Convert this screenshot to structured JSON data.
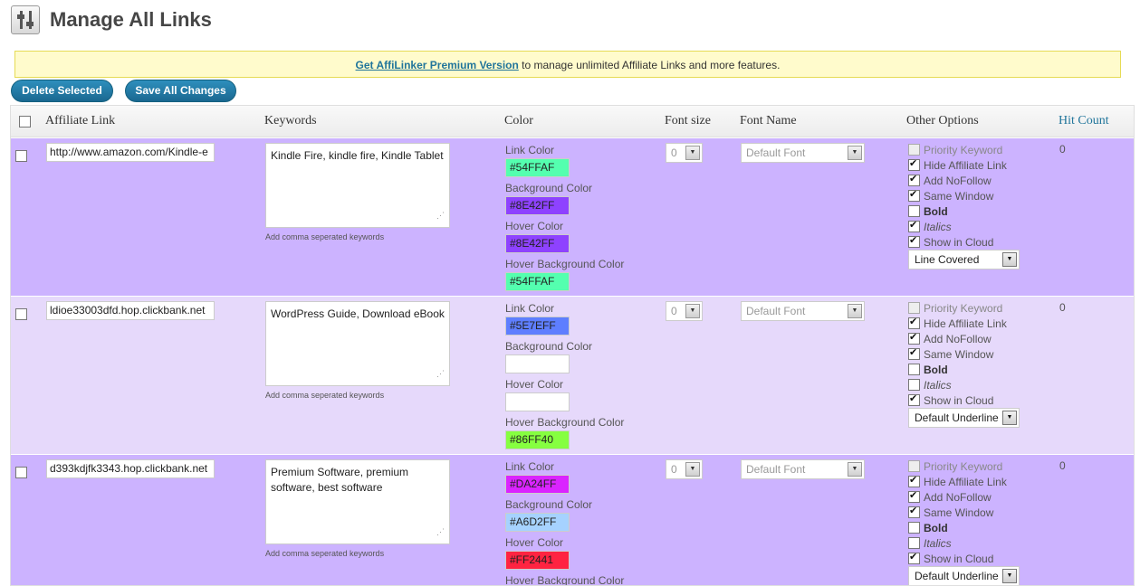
{
  "page": {
    "title": "Manage All Links"
  },
  "notice": {
    "link_text": "Get AffiLinker Premium Version",
    "text": " to manage unlimited Affiliate Links and more features."
  },
  "toolbar": {
    "delete_label": "Delete Selected",
    "save_label": "Save All Changes"
  },
  "table": {
    "headers": {
      "link": "Affiliate Link",
      "keywords": "Keywords",
      "color": "Color",
      "font_size": "Font size",
      "font_name": "Font Name",
      "other": "Other Options",
      "hit_count": "Hit Count"
    },
    "keyword_hint": "Add comma seperated keywords",
    "color_labels": {
      "link": "Link Color",
      "background": "Background Color",
      "hover": "Hover Color",
      "hover_bg": "Hover Background Color"
    },
    "option_labels": {
      "priority": "Priority Keyword",
      "hide": "Hide Affiliate Link",
      "nofollow": "Add NoFollow",
      "same_window": "Same Window",
      "bold": "Bold",
      "italics": "Italics",
      "cloud": "Show in Cloud"
    },
    "rows": [
      {
        "url": "http://www.amazon.com/Kindle-e",
        "keywords": "Kindle Fire, kindle fire, Kindle Tablet",
        "link_color": "#54FFAF",
        "bg_color": "#8E42FF",
        "hover_color": "#8E42FF",
        "hover_bg_color": "#54FFAF",
        "font_size": "0",
        "font_name": "Default Font",
        "options": {
          "priority": false,
          "hide": true,
          "nofollow": true,
          "same_window": true,
          "bold": false,
          "italics": true,
          "cloud": true
        },
        "underline": "Line Covered",
        "hit_count": "0",
        "row_color": "#ccb3ff"
      },
      {
        "url": "ldioe33003dfd.hop.clickbank.net",
        "keywords": "WordPress Guide, Download eBook",
        "link_color": "#5E7EFF",
        "bg_color": "",
        "hover_color": "",
        "hover_bg_color": "#86FF40",
        "font_size": "0",
        "font_name": "Default Font",
        "options": {
          "priority": false,
          "hide": true,
          "nofollow": true,
          "same_window": true,
          "bold": false,
          "italics": false,
          "cloud": true
        },
        "underline": "Default Underline",
        "hit_count": "0",
        "row_color": "#e6d9fb"
      },
      {
        "url": "d393kdjfk3343.hop.clickbank.net",
        "keywords": "Premium Software, premium software, best software",
        "link_color": "#DA24FF",
        "bg_color": "#A6D2FF",
        "hover_color": "#FF2441",
        "hover_bg_color": "",
        "font_size": "0",
        "font_name": "Default Font",
        "options": {
          "priority": false,
          "hide": true,
          "nofollow": true,
          "same_window": true,
          "bold": false,
          "italics": false,
          "cloud": true
        },
        "underline": "Default Underline",
        "hit_count": "0",
        "row_color": "#ccb3ff"
      }
    ]
  }
}
